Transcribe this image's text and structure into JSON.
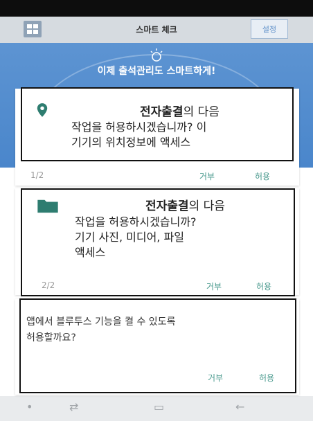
{
  "app": {
    "title": "스마트 체크",
    "settings_label": "설정",
    "hero_text": "이제 출석관리도 스마트하게!"
  },
  "dialogs": [
    {
      "app_name": "전자출결",
      "title_suffix": "의 다음",
      "body_lines": [
        "작업을 허용하시겠습니까? 이",
        "기기의 위치정보에 액세스"
      ],
      "count": "1/2",
      "deny_label": "거부",
      "allow_label": "허용",
      "icon": "location-pin-icon"
    },
    {
      "app_name": "전자출결",
      "title_suffix": "의 다음",
      "body_lines": [
        "작업을 허용하시겠습니까?",
        "기기 사진, 미디어, 파일",
        "액세스"
      ],
      "count": "2/2",
      "deny_label": "거부",
      "allow_label": "허용",
      "icon": "folder-icon"
    },
    {
      "body_lines": [
        "앱에서 블루투스 기능을 켤 수 있도록",
        "허용할까요?"
      ],
      "deny_label": "거부",
      "allow_label": "허용"
    }
  ],
  "colors": {
    "accent": "#4a9a8e",
    "hero_blue": "#4a86cb"
  }
}
